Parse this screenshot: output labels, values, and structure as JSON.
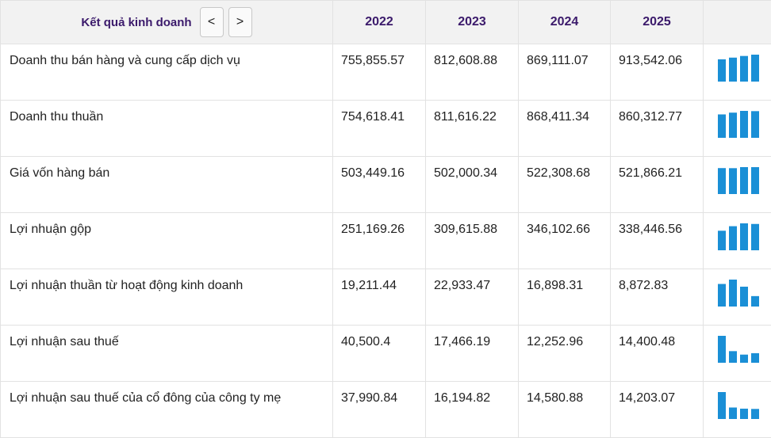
{
  "header": {
    "title": "Kết quả kinh doanh",
    "prev_label": "<",
    "next_label": ">",
    "years": [
      "2022",
      "2023",
      "2024",
      "2025"
    ]
  },
  "rows": [
    {
      "label": "Doanh thu bán hàng và cung cấp dịch vụ",
      "values": [
        "755,855.57",
        "812,608.88",
        "869,111.07",
        "913,542.06"
      ],
      "spark": [
        755855.57,
        812608.88,
        869111.07,
        913542.06
      ]
    },
    {
      "label": "Doanh thu thuần",
      "values": [
        "754,618.41",
        "811,616.22",
        "868,411.34",
        "860,312.77"
      ],
      "spark": [
        754618.41,
        811616.22,
        868411.34,
        860312.77
      ]
    },
    {
      "label": "Giá vốn hàng bán",
      "values": [
        "503,449.16",
        "502,000.34",
        "522,308.68",
        "521,866.21"
      ],
      "spark": [
        503449.16,
        502000.34,
        522308.68,
        521866.21
      ]
    },
    {
      "label": "Lợi nhuận gộp",
      "values": [
        "251,169.26",
        "309,615.88",
        "346,102.66",
        "338,446.56"
      ],
      "spark": [
        251169.26,
        309615.88,
        346102.66,
        338446.56
      ]
    },
    {
      "label": "Lợi nhuận thuần từ hoạt động kinh doanh",
      "values": [
        "19,211.44",
        "22,933.47",
        "16,898.31",
        "8,872.83"
      ],
      "spark": [
        19211.44,
        22933.47,
        16898.31,
        8872.83
      ]
    },
    {
      "label": "Lợi nhuận sau thuế",
      "values": [
        "40,500.4",
        "17,466.19",
        "12,252.96",
        "14,400.48"
      ],
      "spark": [
        40500.4,
        17466.19,
        12252.96,
        14400.48
      ]
    },
    {
      "label": "Lợi nhuận sau thuế của cổ đông của công ty mẹ",
      "values": [
        "37,990.84",
        "16,194.82",
        "14,580.88",
        "14,203.07"
      ],
      "spark": [
        37990.84,
        16194.82,
        14580.88,
        14203.07
      ]
    }
  ],
  "colors": {
    "spark_bar": "#1a8fd6",
    "header_text": "#3b1a6b"
  }
}
